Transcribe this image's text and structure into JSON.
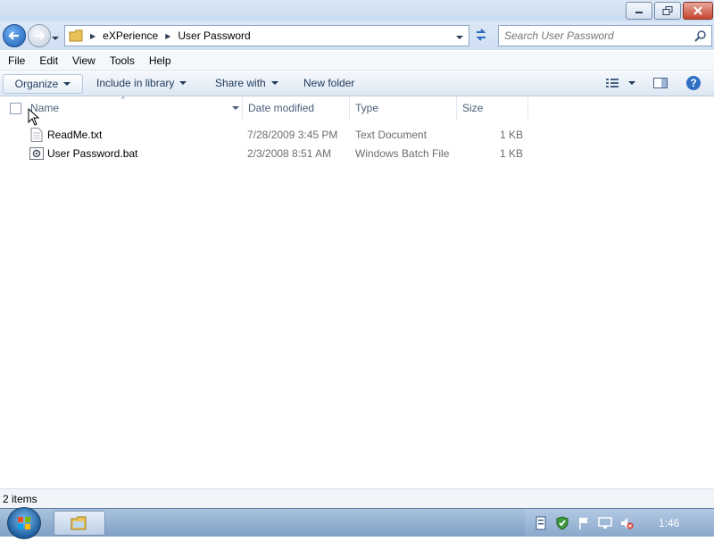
{
  "window": {
    "title": ""
  },
  "address": {
    "crumbs": [
      "eXPerience",
      "User Password"
    ]
  },
  "search": {
    "placeholder": "Search User Password"
  },
  "menu": [
    "File",
    "Edit",
    "View",
    "Tools",
    "Help"
  ],
  "toolbar": {
    "organize": "Organize",
    "include_library": "Include in library",
    "share_with": "Share with",
    "new_folder": "New folder"
  },
  "columns": [
    "Name",
    "Date modified",
    "Type",
    "Size"
  ],
  "files": [
    {
      "name": "ReadMe.txt",
      "date": "7/28/2009 3:45 PM",
      "type": "Text Document",
      "size": "1 KB",
      "icon": "text-file-icon"
    },
    {
      "name": "User Password.bat",
      "date": "2/3/2008 8:51 AM",
      "type": "Windows Batch File",
      "size": "1 KB",
      "icon": "batch-file-icon"
    }
  ],
  "status": {
    "count": "2 items"
  },
  "taskbar": {
    "clock": "1:46"
  },
  "colors": {
    "accent": "#1e5fb4",
    "chrome": "#cfdff2",
    "taskbar": "#8aa8cc"
  }
}
